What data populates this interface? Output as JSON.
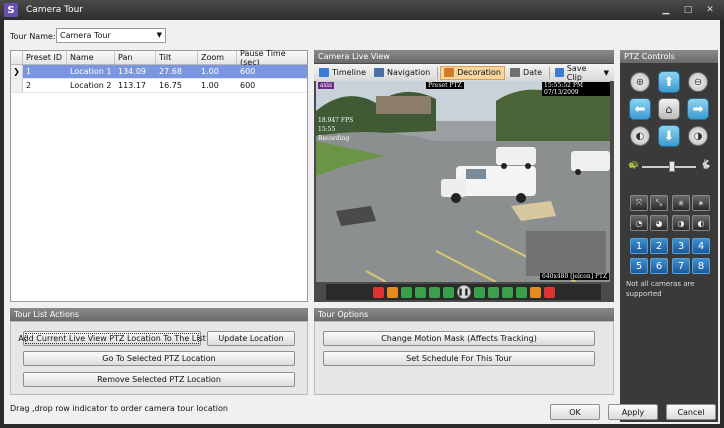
{
  "window": {
    "title": "Camera Tour",
    "app_glyph": "S",
    "min_glyph": "▁",
    "max_glyph": "□",
    "close_glyph": "✕"
  },
  "tour": {
    "label": "Tour Name:",
    "value": "Camera Tour"
  },
  "grid": {
    "columns": [
      "Preset ID",
      "Name",
      "Pan",
      "Tilt",
      "Zoom",
      "Pause Time (sec)"
    ],
    "rows": [
      {
        "indicator": "❯",
        "cells": [
          "1",
          "Location 1",
          "134.09",
          "27.68",
          "1.00",
          "600"
        ]
      },
      {
        "indicator": "",
        "cells": [
          "2",
          "Location 2",
          "113.17",
          "16.75",
          "1.00",
          "600"
        ]
      }
    ],
    "selected_row": 0
  },
  "live": {
    "title": "Camera Live View",
    "toolbar": [
      {
        "label": "Timeline",
        "icon": "timeline-icon",
        "color": "#3a7bd5"
      },
      {
        "label": "Navigation",
        "icon": "navigation-icon",
        "color": "#4a6fa5"
      },
      {
        "label": "Decoration",
        "icon": "decoration-icon",
        "color": "#d07a2a"
      },
      {
        "label": "Date",
        "icon": "date-icon",
        "color": "#707070"
      },
      {
        "label": "Save Clip",
        "icon": "save-clip-icon",
        "color": "#3a7bd5"
      }
    ],
    "active_tool": 2,
    "osd": {
      "brand": "axis",
      "preset": "Preset PTZ",
      "datetime": "15:55:52 PM 07/13/2009",
      "fps": "18.947 FPS",
      "time": "15:55",
      "recording": "Recording",
      "resolution": "640x480 [jelcon] PTZ"
    }
  },
  "tour_list_actions": {
    "title": "Tour List Actions",
    "add_label": "Add Current Live View PTZ Location To The List",
    "update_label": "Update Location",
    "goto_label": "Go To Selected PTZ Location",
    "remove_label": "Remove Selected PTZ Location"
  },
  "tour_options": {
    "title": "Tour Options",
    "motion_mask_label": "Change Motion Mask (Affects Tracking)",
    "schedule_label": "Set Schedule For This Tour"
  },
  "ptz": {
    "title": "PTZ Controls",
    "zoom_in": "⊕",
    "zoom_out": "⊖",
    "up": "⬆",
    "down": "⬇",
    "left": "⬅",
    "right": "➡",
    "home": "⌂",
    "focus_near": "◐",
    "focus_far": "◑",
    "speed_slow": "🐢",
    "speed_fast": "🐇",
    "speed_level": 0.55,
    "function_buttons": [
      "⤧",
      "⤡",
      "✳",
      "✴",
      "◔",
      "◕",
      "◑",
      "◐"
    ],
    "presets": [
      "1",
      "2",
      "3",
      "4",
      "5",
      "6",
      "7",
      "8"
    ],
    "note": "Not all cameras are supported"
  },
  "status": "Drag ,drop row indicator to order camera tour location",
  "footer": {
    "ok_label": "OK",
    "apply_label": "Apply",
    "cancel_label": "Cancel"
  },
  "colors": {
    "selected_row": "#7b96e0",
    "panel_header": "#7a7a7a",
    "ptz_bg": "#3a3a3a",
    "accent_blue": "#3a9cd0"
  }
}
